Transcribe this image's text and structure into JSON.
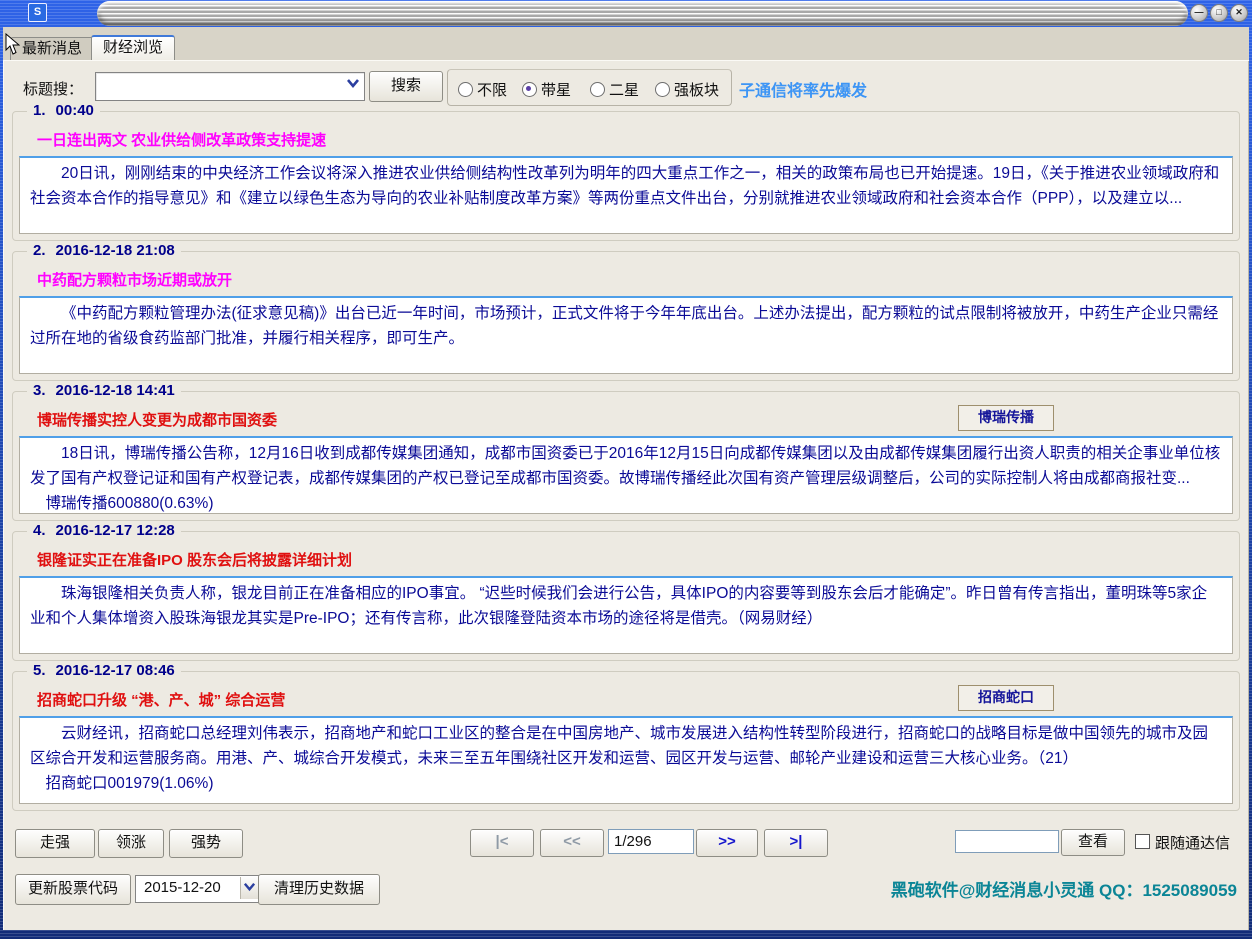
{
  "window": {
    "app_icon": "S",
    "minimize": "—",
    "maximize": "□",
    "close": "✕"
  },
  "tabs": {
    "latest": "最新消息",
    "finance": "财经浏览"
  },
  "search": {
    "label": "标题搜：",
    "combo_value": "",
    "search_button": "搜索",
    "radio_unlimited": "不限",
    "radio_starred": "带星",
    "radio_two_star": "二星",
    "radio_strong_sector": "强板块",
    "marquee": "子通信将率先爆发"
  },
  "news": [
    {
      "no": "1.",
      "time": "00:40",
      "title": "一日连出两文 农业供给侧改革政策支持提速",
      "body": "20日讯，刚刚结束的中央经济工作会议将深入推进农业供给侧结构性改革列为明年的四大重点工作之一，相关的政策布局也已开始提速。19日，《关于推进农业领域政府和社会资本合作的指导意见》和《建立以绿色生态为导向的农业补贴制度改革方案》等两份重点文件出台，分别就推进农业领域政府和社会资本合作（PPP），以及建立以..."
    },
    {
      "no": "2.",
      "time": "2016-12-18 21:08",
      "title": "中药配方颗粒市场近期或放开",
      "body": "《中药配方颗粒管理办法(征求意见稿)》出台已近一年时间，市场预计，正式文件将于今年年底出台。上述办法提出，配方颗粒的试点限制将被放开，中药生产企业只需经过所在地的省级食药监部门批准，并履行相关程序，即可生产。"
    },
    {
      "no": "3.",
      "time": "2016-12-18 14:41",
      "title": "博瑞传播实控人变更为成都市国资委",
      "tag": "博瑞传播",
      "body": "18日讯，博瑞传播公告称，12月16日收到成都传媒集团通知，成都市国资委已于2016年12月15日向成都传媒集团以及由成都传媒集团履行出资人职责的相关企事业单位核发了国有产权登记证和国有产权登记表，成都传媒集团的产权已登记至成都市国资委。故博瑞传播经此次国有资产管理层级调整后，公司的实际控制人将由成都商报社变...",
      "stock": "博瑞传播600880(0.63%)"
    },
    {
      "no": "4.",
      "time": "2016-12-17 12:28",
      "title": "银隆证实正在准备IPO 股东会后将披露详细计划",
      "body": "珠海银隆相关负责人称，银龙目前正在准备相应的IPO事宜。 “迟些时候我们会进行公告，具体IPO的内容要等到股东会后才能确定”。昨日曾有传言指出，董明珠等5家企业和个人集体增资入股珠海银龙其实是Pre-IPO；还有传言称，此次银隆登陆资本市场的途径将是借壳。（网易财经）"
    },
    {
      "no": "5.",
      "time": "2016-12-17 08:46",
      "title": "招商蛇口升级 “港、产、城” 综合运营",
      "tag": "招商蛇口",
      "body": "云财经讯，招商蛇口总经理刘伟表示，招商地产和蛇口工业区的整合是在中国房地产、城市发展进入结构性转型阶段进行，招商蛇口的战略目标是做中国领先的城市及园区综合开发和运营服务商。用港、产、城综合开发模式，未来三至五年围绕社区开发和运营、园区开发与运营、邮轮产业建设和运营三大核心业务。（21）",
      "stock": "招商蛇口001979(1.06%)"
    }
  ],
  "footer": {
    "btn_zouqiang": "走强",
    "btn_lingzhang": "领涨",
    "btn_qiangshi": "强势",
    "pager_first": "|<",
    "pager_prev": "<<",
    "pager_page": "1/296",
    "pager_next": ">>",
    "pager_last": ">|",
    "lookup_value": "",
    "btn_view": "查看",
    "chk_follow": "跟随通达信",
    "btn_update": "更新股票代码",
    "date_value": "2015-12-20",
    "btn_clean": "清理历史数据",
    "credit": "黑砲软件@财经消息小灵通 QQ：1525089059"
  },
  "colors": {
    "title_magenta": "#ff00ff",
    "title_red": "#e01010",
    "body_navy": "#0a0a96",
    "marquee_blue": "#3d95f5",
    "credit_teal": "#0b8596",
    "titlebar_blue": "#2a5ae0"
  }
}
